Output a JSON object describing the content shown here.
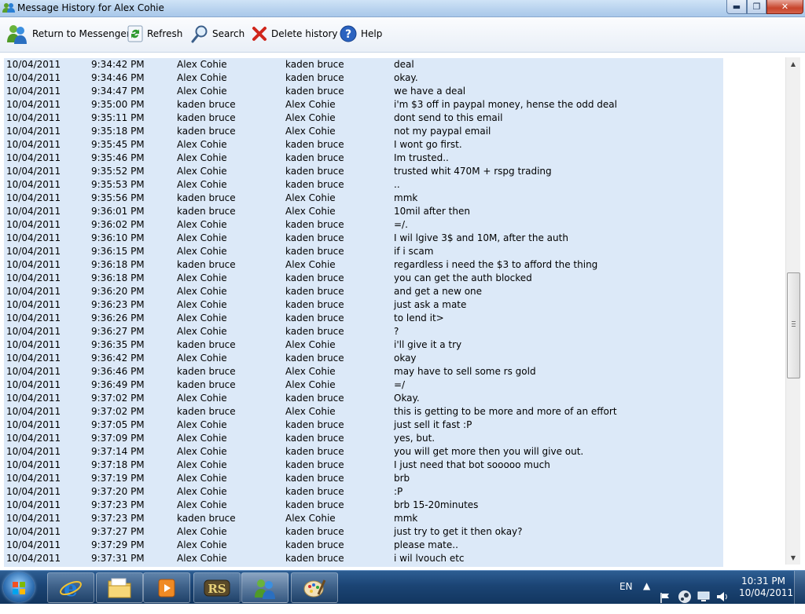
{
  "window": {
    "title": "Message History for Alex Cohie"
  },
  "toolbar": {
    "return_label": "Return to Messenger",
    "refresh_label": "Refresh",
    "search_label": "Search",
    "delete_label": "Delete history",
    "help_label": "Help"
  },
  "messages": [
    {
      "date": "10/04/2011",
      "time": "9:34:42 PM",
      "from": "Alex Cohie",
      "to": "kaden bruce",
      "message": "deal"
    },
    {
      "date": "10/04/2011",
      "time": "9:34:46 PM",
      "from": "Alex Cohie",
      "to": "kaden bruce",
      "message": "okay."
    },
    {
      "date": "10/04/2011",
      "time": "9:34:47 PM",
      "from": "Alex Cohie",
      "to": "kaden bruce",
      "message": "we have a deal"
    },
    {
      "date": "10/04/2011",
      "time": "9:35:00 PM",
      "from": "kaden bruce",
      "to": "Alex Cohie",
      "message": "i'm $3 off in paypal money, hense the odd deal"
    },
    {
      "date": "10/04/2011",
      "time": "9:35:11 PM",
      "from": "kaden bruce",
      "to": "Alex Cohie",
      "message": "dont send to this email"
    },
    {
      "date": "10/04/2011",
      "time": "9:35:18 PM",
      "from": "kaden bruce",
      "to": "Alex Cohie",
      "message": "not my paypal email"
    },
    {
      "date": "10/04/2011",
      "time": "9:35:45 PM",
      "from": "Alex Cohie",
      "to": "kaden bruce",
      "message": "I wont go first."
    },
    {
      "date": "10/04/2011",
      "time": "9:35:46 PM",
      "from": "Alex Cohie",
      "to": "kaden bruce",
      "message": "Im trusted.."
    },
    {
      "date": "10/04/2011",
      "time": "9:35:52 PM",
      "from": "Alex Cohie",
      "to": "kaden bruce",
      "message": "trusted whit 470M + rspg trading"
    },
    {
      "date": "10/04/2011",
      "time": "9:35:53 PM",
      "from": "Alex Cohie",
      "to": "kaden bruce",
      "message": ".."
    },
    {
      "date": "10/04/2011",
      "time": "9:35:56 PM",
      "from": "kaden bruce",
      "to": "Alex Cohie",
      "message": "mmk"
    },
    {
      "date": "10/04/2011",
      "time": "9:36:01 PM",
      "from": "kaden bruce",
      "to": "Alex Cohie",
      "message": "10mil after then"
    },
    {
      "date": "10/04/2011",
      "time": "9:36:02 PM",
      "from": "Alex Cohie",
      "to": "kaden bruce",
      "message": "=/."
    },
    {
      "date": "10/04/2011",
      "time": "9:36:10 PM",
      "from": "Alex Cohie",
      "to": "kaden bruce",
      "message": "I wil lgive 3$ and 10M, after the auth"
    },
    {
      "date": "10/04/2011",
      "time": "9:36:15 PM",
      "from": "Alex Cohie",
      "to": "kaden bruce",
      "message": "if i scam"
    },
    {
      "date": "10/04/2011",
      "time": "9:36:18 PM",
      "from": "kaden bruce",
      "to": "Alex Cohie",
      "message": "regardless i need the $3 to afford the thing"
    },
    {
      "date": "10/04/2011",
      "time": "9:36:18 PM",
      "from": "Alex Cohie",
      "to": "kaden bruce",
      "message": "you can get the auth blocked"
    },
    {
      "date": "10/04/2011",
      "time": "9:36:20 PM",
      "from": "Alex Cohie",
      "to": "kaden bruce",
      "message": "and get a new one"
    },
    {
      "date": "10/04/2011",
      "time": "9:36:23 PM",
      "from": "Alex Cohie",
      "to": "kaden bruce",
      "message": "just ask a mate"
    },
    {
      "date": "10/04/2011",
      "time": "9:36:26 PM",
      "from": "Alex Cohie",
      "to": "kaden bruce",
      "message": "to lend it>"
    },
    {
      "date": "10/04/2011",
      "time": "9:36:27 PM",
      "from": "Alex Cohie",
      "to": "kaden bruce",
      "message": "?"
    },
    {
      "date": "10/04/2011",
      "time": "9:36:35 PM",
      "from": "kaden bruce",
      "to": "Alex Cohie",
      "message": "i'll give it a try"
    },
    {
      "date": "10/04/2011",
      "time": "9:36:42 PM",
      "from": "Alex Cohie",
      "to": "kaden bruce",
      "message": "okay"
    },
    {
      "date": "10/04/2011",
      "time": "9:36:46 PM",
      "from": "kaden bruce",
      "to": "Alex Cohie",
      "message": "may have to sell some rs gold"
    },
    {
      "date": "10/04/2011",
      "time": "9:36:49 PM",
      "from": "kaden bruce",
      "to": "Alex Cohie",
      "message": "=/"
    },
    {
      "date": "10/04/2011",
      "time": "9:37:02 PM",
      "from": "Alex Cohie",
      "to": "kaden bruce",
      "message": "Okay."
    },
    {
      "date": "10/04/2011",
      "time": "9:37:02 PM",
      "from": "kaden bruce",
      "to": "Alex Cohie",
      "message": "this is getting to be more and more of an effort"
    },
    {
      "date": "10/04/2011",
      "time": "9:37:05 PM",
      "from": "Alex Cohie",
      "to": "kaden bruce",
      "message": "just sell it fast :P"
    },
    {
      "date": "10/04/2011",
      "time": "9:37:09 PM",
      "from": "Alex Cohie",
      "to": "kaden bruce",
      "message": "yes, but."
    },
    {
      "date": "10/04/2011",
      "time": "9:37:14 PM",
      "from": "Alex Cohie",
      "to": "kaden bruce",
      "message": "you will get more then you will give out."
    },
    {
      "date": "10/04/2011",
      "time": "9:37:18 PM",
      "from": "Alex Cohie",
      "to": "kaden bruce",
      "message": "I just need that bot sooooo much"
    },
    {
      "date": "10/04/2011",
      "time": "9:37:19 PM",
      "from": "Alex Cohie",
      "to": "kaden bruce",
      "message": "brb"
    },
    {
      "date": "10/04/2011",
      "time": "9:37:20 PM",
      "from": "Alex Cohie",
      "to": "kaden bruce",
      "message": ":P"
    },
    {
      "date": "10/04/2011",
      "time": "9:37:23 PM",
      "from": "Alex Cohie",
      "to": "kaden bruce",
      "message": "brb 15-20minutes"
    },
    {
      "date": "10/04/2011",
      "time": "9:37:23 PM",
      "from": "kaden bruce",
      "to": "Alex Cohie",
      "message": "mmk"
    },
    {
      "date": "10/04/2011",
      "time": "9:37:27 PM",
      "from": "Alex Cohie",
      "to": "kaden bruce",
      "message": "just try to get it then okay?"
    },
    {
      "date": "10/04/2011",
      "time": "9:37:29 PM",
      "from": "Alex Cohie",
      "to": "kaden bruce",
      "message": "please mate.."
    },
    {
      "date": "10/04/2011",
      "time": "9:37:31 PM",
      "from": "Alex Cohie",
      "to": "kaden bruce",
      "message": "i wil lvouch etc"
    }
  ],
  "taskbar": {
    "language": "EN",
    "time": "10:31 PM",
    "date": "10/04/2011",
    "apps": [
      "ie-icon",
      "folder-icon",
      "media-player-icon",
      "runescape-icon",
      "messenger-icon",
      "paint-icon"
    ]
  },
  "colors": {
    "list_background": "#dce9f8",
    "taskbar": "#1b4474"
  }
}
